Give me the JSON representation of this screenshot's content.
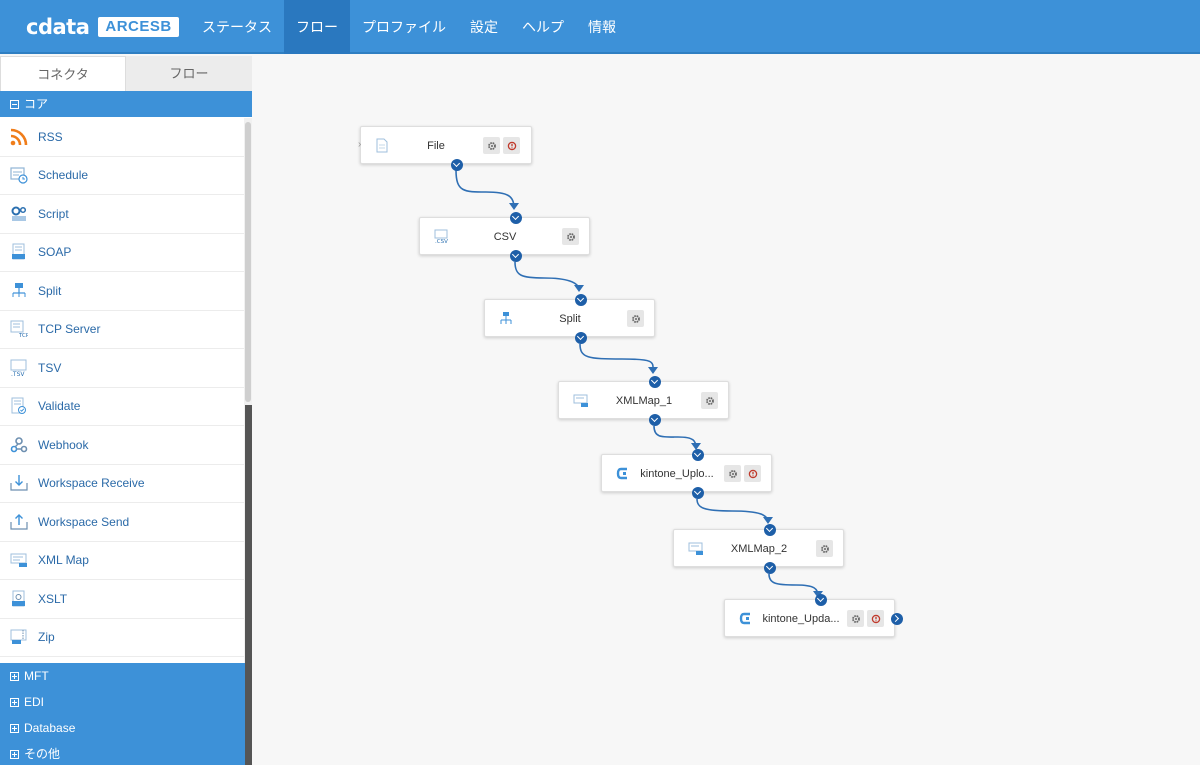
{
  "header": {
    "brand": "cdata",
    "product": "ARCESB",
    "nav": [
      "ステータス",
      "フロー",
      "プロファイル",
      "設定",
      "ヘルプ",
      "情報"
    ],
    "active_nav": "フロー"
  },
  "sidebar": {
    "tabs": [
      "コネクタ",
      "フロー"
    ],
    "sections": {
      "core": "コア",
      "mft": "MFT",
      "edi": "EDI",
      "database": "Database",
      "other": "その他"
    },
    "connectors": [
      {
        "label": "RSS",
        "icon": "rss-icon"
      },
      {
        "label": "Schedule",
        "icon": "schedule-icon"
      },
      {
        "label": "Script",
        "icon": "script-icon"
      },
      {
        "label": "SOAP",
        "icon": "soap-icon"
      },
      {
        "label": "Split",
        "icon": "split-icon"
      },
      {
        "label": "TCP Server",
        "icon": "tcp-icon"
      },
      {
        "label": "TSV",
        "icon": "tsv-icon"
      },
      {
        "label": "Validate",
        "icon": "validate-icon"
      },
      {
        "label": "Webhook",
        "icon": "webhook-icon"
      },
      {
        "label": "Workspace Receive",
        "icon": "receive-icon"
      },
      {
        "label": "Workspace Send",
        "icon": "send-icon"
      },
      {
        "label": "XML Map",
        "icon": "xmlmap-icon"
      },
      {
        "label": "XSLT",
        "icon": "xslt-icon"
      },
      {
        "label": "Zip",
        "icon": "zip-icon"
      }
    ]
  },
  "flow": {
    "nodes": [
      {
        "id": "file",
        "label": "File",
        "icon": "file-icon"
      },
      {
        "id": "csv",
        "label": "CSV",
        "icon": "csv-icon"
      },
      {
        "id": "split",
        "label": "Split",
        "icon": "split-icon"
      },
      {
        "id": "xmlmap1",
        "label": "XMLMap_1",
        "icon": "xmlmap-icon"
      },
      {
        "id": "kintone1",
        "label": "kintone_Uplo...",
        "icon": "kintone-icon"
      },
      {
        "id": "xmlmap2",
        "label": "XMLMap_2",
        "icon": "xmlmap-icon"
      },
      {
        "id": "kintone2",
        "label": "kintone_Upda...",
        "icon": "kintone-icon"
      }
    ]
  },
  "colors": {
    "accent": "#3d91d8",
    "link": "#1e5fa8",
    "error": "#c0392b"
  }
}
